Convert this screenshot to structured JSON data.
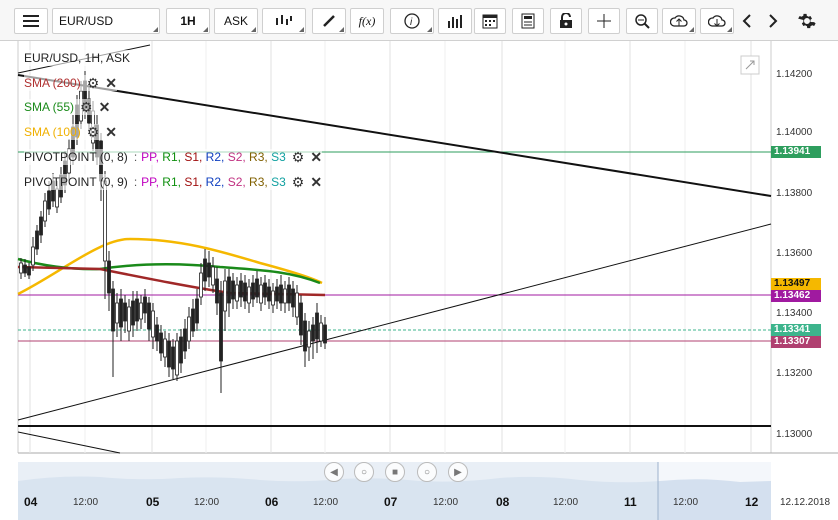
{
  "toolbar": {
    "symbol": "EUR/USD",
    "timeframe": "1H",
    "price_type": "ASK",
    "indicator_label": "f(x)",
    "info_label": "i"
  },
  "chart": {
    "title": "EUR/USD, 1H, ASK",
    "legend": [
      {
        "name": "SMA (200)",
        "color": "#b03030"
      },
      {
        "name": "SMA (55)",
        "color": "#1a8a1a"
      },
      {
        "name": "SMA (100)",
        "color": "#f0b000"
      }
    ],
    "pivots": [
      {
        "name": "PIVOTPOINT (0, 8)",
        "items": [
          "PP",
          "R1",
          "S1",
          "R2",
          "S2",
          "R3",
          "S3"
        ]
      },
      {
        "name": "PIVOTPOINT (0, 9)",
        "items": [
          "PP",
          "R1",
          "S1",
          "R2",
          "S2",
          "R3",
          "S3"
        ]
      }
    ],
    "pivot_colors": {
      "PP": "#c000c0",
      "R1": "#109010",
      "S1": "#a01010",
      "R2": "#1040c0",
      "S2": "#c03080",
      "R3": "#806000",
      "S3": "#10a0a0"
    },
    "y_ticks": [
      "1.14200",
      "1.14000",
      "1.13800",
      "1.13600",
      "1.13400",
      "1.13200",
      "1.13000"
    ],
    "price_tags": [
      {
        "value": "1.13941",
        "color": "#2e9e5e"
      },
      {
        "value": "1.13497",
        "color": "#f5b800",
        "text_color": "#111111"
      },
      {
        "value": "1.13462",
        "color": "#a01aa0"
      },
      {
        "value": "1.13341",
        "color": "#3cb48c"
      },
      {
        "value": "1.13307",
        "color": "#b04070"
      }
    ],
    "x_ticks": [
      {
        "label": "04",
        "major": true
      },
      {
        "label": "12:00",
        "major": false
      },
      {
        "label": "05",
        "major": true
      },
      {
        "label": "12:00",
        "major": false
      },
      {
        "label": "06",
        "major": true
      },
      {
        "label": "12:00",
        "major": false
      },
      {
        "label": "07",
        "major": true
      },
      {
        "label": "12:00",
        "major": false
      },
      {
        "label": "08",
        "major": true
      },
      {
        "label": "12:00",
        "major": false
      },
      {
        "label": "11",
        "major": true
      },
      {
        "label": "12:00",
        "major": false
      },
      {
        "label": "12",
        "major": true
      },
      {
        "label": "12.12.2018",
        "major": false
      }
    ]
  }
}
